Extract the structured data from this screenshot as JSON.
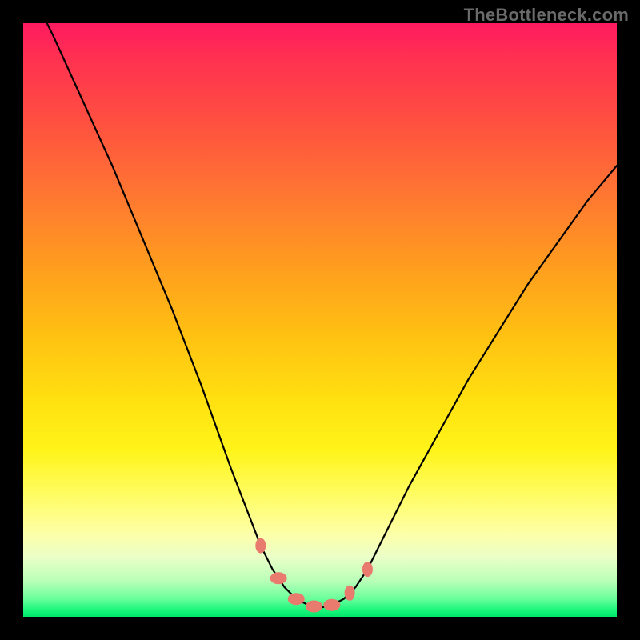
{
  "watermark": "TheBottleneck.com",
  "colors": {
    "background": "#000000",
    "curve_stroke": "#000000",
    "marker_fill": "#e97a6e",
    "gradient_top": "#ff1a60",
    "gradient_bottom": "#00e56a"
  },
  "chart_data": {
    "type": "line",
    "title": "",
    "xlabel": "",
    "ylabel": "",
    "xlim": [
      0,
      100
    ],
    "ylim": [
      0,
      100
    ],
    "grid": false,
    "legend": false,
    "series": [
      {
        "name": "bottleneck-curve",
        "x": [
          0,
          5,
          10,
          15,
          20,
          25,
          30,
          35,
          40,
          42,
          44,
          46,
          48,
          50,
          52,
          54,
          56,
          58,
          60,
          65,
          70,
          75,
          80,
          85,
          90,
          95,
          100
        ],
        "values": [
          108,
          98,
          87,
          76,
          64,
          52,
          39,
          25,
          12,
          8,
          5,
          3,
          2,
          1.5,
          2,
          3,
          5,
          8,
          12,
          22,
          31,
          40,
          48,
          56,
          63,
          70,
          76
        ]
      }
    ],
    "highlight_range_x": [
      40,
      58
    ],
    "annotations": []
  }
}
